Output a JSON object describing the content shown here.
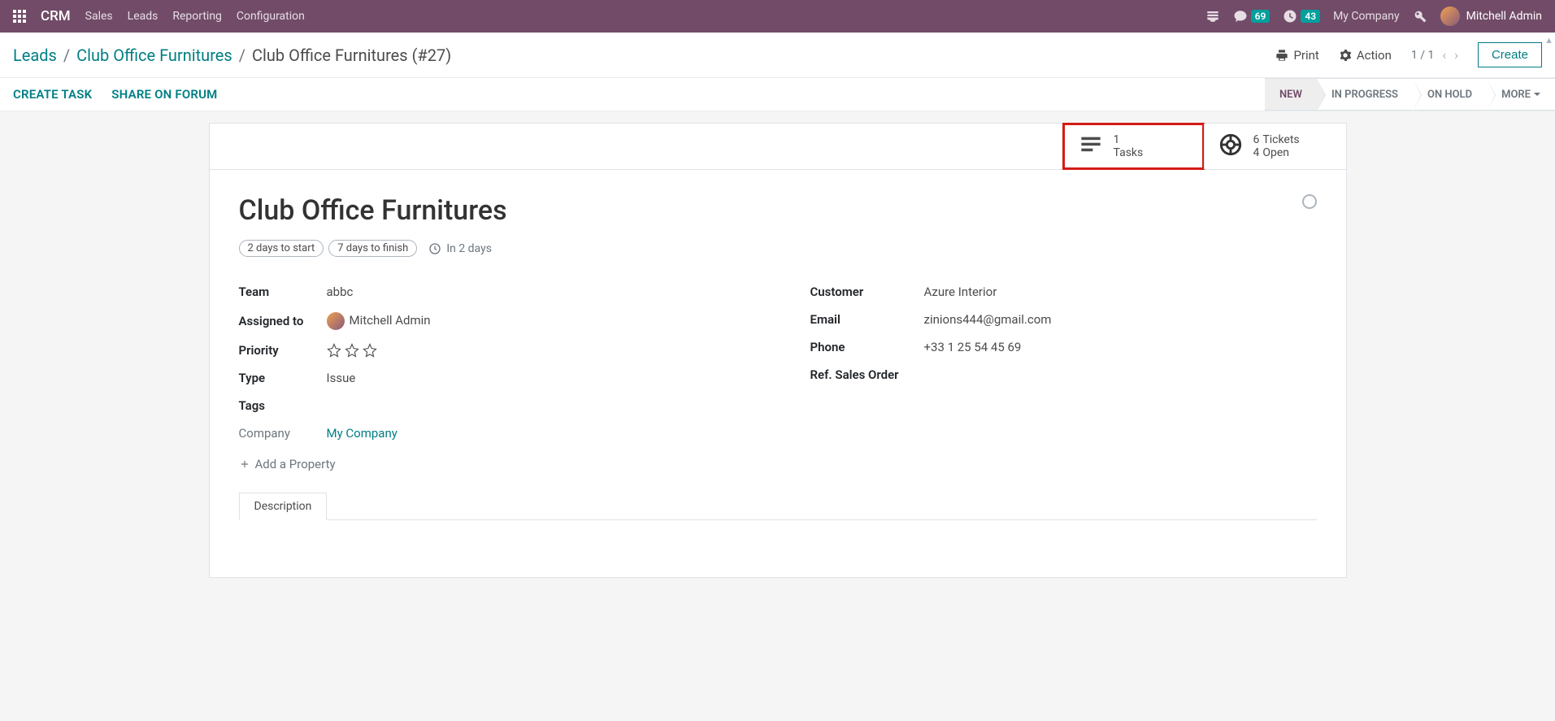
{
  "topbar": {
    "brand": "CRM",
    "menu": [
      "Sales",
      "Leads",
      "Reporting",
      "Configuration"
    ],
    "messages_badge": "69",
    "activities_badge": "43",
    "company": "My Company",
    "user_name": "Mitchell Admin"
  },
  "breadcrumb": {
    "items": [
      "Leads",
      "Club Office Furnitures"
    ],
    "current": "Club Office Furnitures (#27)"
  },
  "header_actions": {
    "print": "Print",
    "action": "Action",
    "pager": "1 / 1",
    "create": "Create"
  },
  "action_bar": {
    "create_task": "CREATE TASK",
    "share_forum": "SHARE ON FORUM",
    "statuses": [
      "NEW",
      "IN PROGRESS",
      "ON HOLD",
      "MORE"
    ],
    "active_status_index": 0
  },
  "stat_boxes": {
    "tasks": {
      "count": "1",
      "label": "Tasks"
    },
    "tickets": {
      "count": "6",
      "label1": "Tickets",
      "open_count": "4",
      "label2": "Open"
    }
  },
  "record": {
    "title": "Club Office Furnitures",
    "chips": [
      "2 days to start",
      "7 days to finish"
    ],
    "due_in": "In 2 days",
    "fields_left": {
      "team_lbl": "Team",
      "team_val": "abbc",
      "assigned_lbl": "Assigned to",
      "assigned_val": "Mitchell Admin",
      "priority_lbl": "Priority",
      "type_lbl": "Type",
      "type_val": "Issue",
      "tags_lbl": "Tags",
      "company_lbl": "Company",
      "company_val": "My Company"
    },
    "fields_right": {
      "customer_lbl": "Customer",
      "customer_val": "Azure Interior",
      "email_lbl": "Email",
      "email_val": "zinions444@gmail.com",
      "phone_lbl": "Phone",
      "phone_val": "+33 1 25 54 45 69",
      "refso_lbl": "Ref. Sales Order"
    },
    "add_property": "Add a Property",
    "tabs": [
      "Description"
    ]
  }
}
